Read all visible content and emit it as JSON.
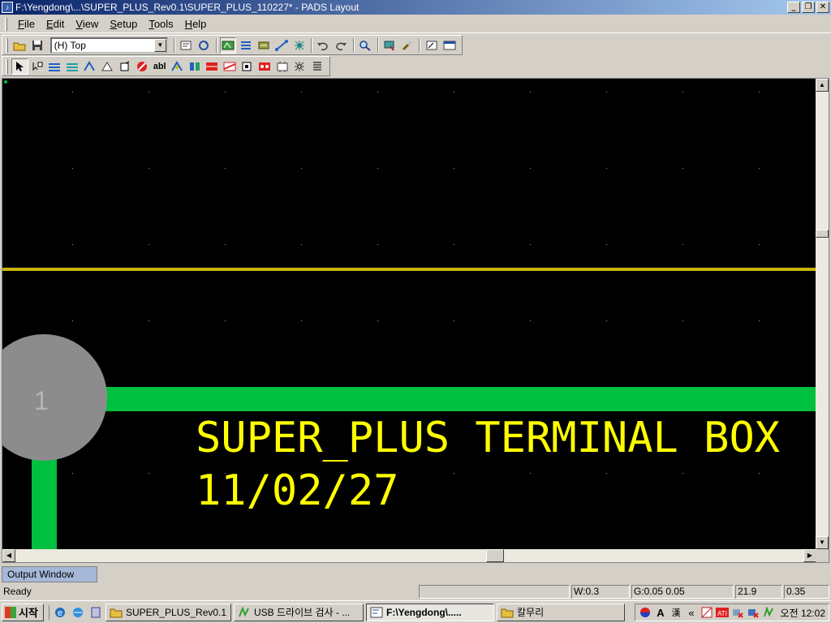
{
  "window": {
    "title": "F:\\Yengdong\\...\\SUPER_PLUS_Rev0.1\\SUPER_PLUS_110227* - PADS Layout",
    "controls": [
      "minimize",
      "restore",
      "close"
    ]
  },
  "menu": {
    "items": [
      {
        "id": "file",
        "underline": "F",
        "rest": "ile"
      },
      {
        "id": "edit",
        "underline": "E",
        "rest": "dit"
      },
      {
        "id": "view",
        "underline": "V",
        "rest": "iew"
      },
      {
        "id": "setup",
        "underline": "S",
        "rest": "etup"
      },
      {
        "id": "tools",
        "underline": "T",
        "rest": "ools"
      },
      {
        "id": "help",
        "underline": "H",
        "rest": "elp"
      }
    ]
  },
  "toolbar": {
    "layer_value": "(H) Top"
  },
  "canvas": {
    "pad_label": "1",
    "text_line1": "SUPER_PLUS TERMINAL BOX",
    "text_line2": "11/02/27",
    "colors": {
      "background": "#000000",
      "trace_green": "#00c040",
      "board_outline": "#c8b400",
      "pad": "#8c8c8c",
      "silkscreen": "#ffff00"
    }
  },
  "output_window": {
    "label": "Output Window"
  },
  "status": {
    "ready": "Ready",
    "width": "W:0.3",
    "grid": "G:0.05 0.05",
    "x": "21.9",
    "y": "0.35"
  },
  "taskbar": {
    "start_label": "시작",
    "tasks": [
      {
        "label": "SUPER_PLUS_Rev0.1",
        "active": false
      },
      {
        "label": "USB 드라이브 검사 - ...",
        "active": false
      },
      {
        "label": "F:\\Yengdong\\.....",
        "active": true
      },
      {
        "label": "칼무리",
        "active": false
      }
    ],
    "tray_text": "«",
    "clock": "오전 12:02"
  }
}
